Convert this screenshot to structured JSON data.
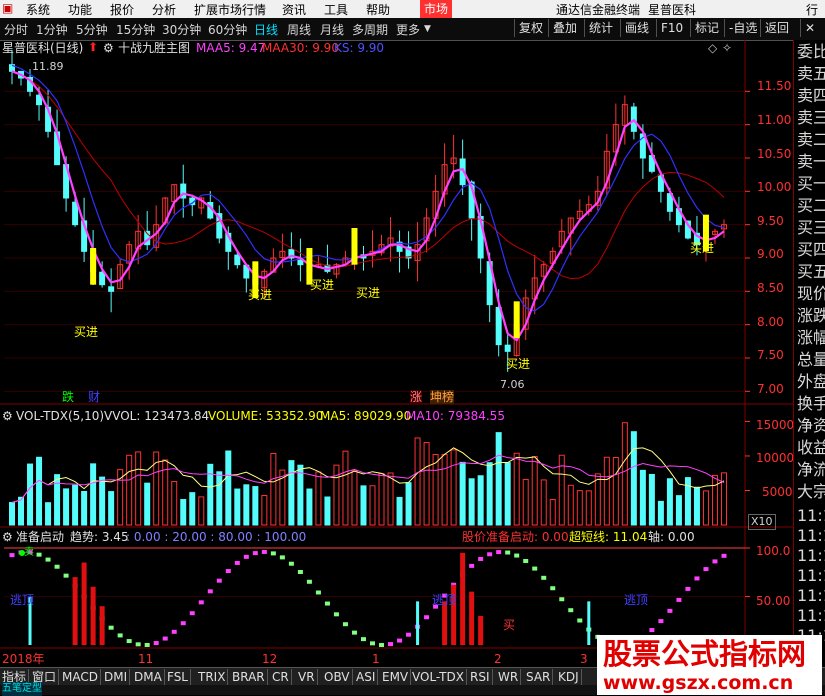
{
  "menubar": {
    "items": [
      "系统",
      "功能",
      "报价",
      "分析",
      "扩展市场行情",
      "资讯",
      "工具",
      "帮助"
    ],
    "active_item": "市场",
    "terminal_title": "通达信金融终端",
    "stock_name": "星普医科",
    "right_item": "行"
  },
  "periods": [
    "分时",
    "1分钟",
    "5分钟",
    "15分钟",
    "30分钟",
    "60分钟",
    "日线",
    "周线",
    "月线",
    "多周期",
    "更多"
  ],
  "selected_period": "日线",
  "right_buttons": [
    "复权",
    "叠加",
    "统计",
    "画线",
    "F10",
    "标记",
    "-自选",
    "返回"
  ],
  "main_panel": {
    "stock_label": "星普医科(日线)",
    "indicator_name": "十战九胜主图",
    "maa5": "MAA5: 9.47",
    "maa30": "MAA30: 9.90",
    "ks": "KS: 9.90",
    "price_ticks": [
      "11.50",
      "11.00",
      "10.50",
      "10.00",
      "9.50",
      "9.00",
      "8.50",
      "8.00",
      "7.50",
      "7.00"
    ],
    "high_label": "11.89",
    "low_label": "7.06",
    "buy_label": "买进",
    "tags": [
      "跌",
      "财",
      "涨",
      "坤榜"
    ]
  },
  "volume_panel": {
    "name": "VOL-TDX(5,10)",
    "vvol": "VVOL: 123473.84",
    "volume": "VOLUME: 53352.90",
    "ma5": "MA5: 89029.90",
    "ma10": "MA10: 79384.55",
    "ticks": [
      "15000",
      "10000",
      "5000"
    ],
    "unit": "X10"
  },
  "sub_panel": {
    "name": "准备启动",
    "trend": "趋势: 3.45",
    "levels": ": 0.00 : 20.00 : 80.00 : 100.00",
    "price_ready": "股价准备启动: 0.00",
    "super_short": "超短线: 11.04",
    "axis": "轴: 0.00",
    "ticks": [
      "100.0",
      "50.00"
    ],
    "escape_label": "逃顶",
    "buy_mark": "买",
    "sell_mark": "卖"
  },
  "x_axis": {
    "labels": [
      "2018年",
      "11",
      "12",
      "1",
      "2",
      "3"
    ]
  },
  "right_panel": {
    "items": [
      "委比",
      "卖五",
      "卖四",
      "卖三",
      "卖二",
      "卖一",
      "买一",
      "买二",
      "买三",
      "买四",
      "买五",
      "现价",
      "涨跌",
      "涨幅",
      "总量",
      "外盘",
      "换手",
      "净资",
      "收益",
      "净流",
      "大宗"
    ],
    "time_ticks": [
      "11:1",
      "11:1",
      "11:1",
      "11:1",
      "11:1",
      "11:1",
      "11:1",
      "11:1"
    ]
  },
  "tabs": [
    "指标",
    "窗口",
    "MACD",
    "DMI",
    "DMA",
    "FSL",
    "TRIX",
    "BRAR",
    "CR",
    "VR",
    "OBV",
    "ASI",
    "EMV",
    "VOL-TDX",
    "RSI",
    "WR",
    "SAR",
    "KDJ"
  ],
  "status_label": "五笔定型",
  "watermark": {
    "title": "股票公式指标网",
    "url": "www.gszx.com.cn"
  },
  "colors": {
    "up": "#ff3232",
    "down": "#54fcfc",
    "ma_fast": "#ff40ff",
    "ma_blue": "#3030ff",
    "ma_red": "#c00000",
    "yellow": "#ffff00",
    "grid": "#800000"
  },
  "chart_data": {
    "type": "candlestick",
    "y_range": [
      6.9,
      12.0
    ],
    "closes": [
      11.8,
      11.7,
      11.5,
      11.3,
      10.9,
      10.4,
      9.9,
      9.5,
      9.1,
      8.8,
      8.6,
      8.5,
      8.9,
      9.2,
      9.4,
      9.2,
      9.5,
      9.9,
      10.1,
      9.9,
      9.8,
      9.9,
      9.6,
      9.3,
      9.1,
      8.9,
      8.7,
      8.6,
      8.8,
      9.0,
      9.1,
      9.0,
      8.9,
      8.8,
      8.9,
      8.8,
      8.9,
      9.0,
      9.1,
      9.0,
      9.1,
      9.2,
      9.3,
      9.1,
      9.0,
      9.2,
      9.6,
      10.0,
      10.4,
      10.5,
      10.1,
      9.6,
      9.0,
      8.3,
      7.7,
      7.6,
      8.0,
      8.4,
      8.7,
      8.9,
      9.1,
      9.4,
      9.6,
      9.7,
      9.8,
      10.0,
      10.6,
      11.0,
      11.3,
      10.9,
      10.5,
      10.3,
      10.0,
      9.7,
      9.5,
      9.3,
      9.2,
      9.3,
      9.4,
      9.5
    ]
  }
}
